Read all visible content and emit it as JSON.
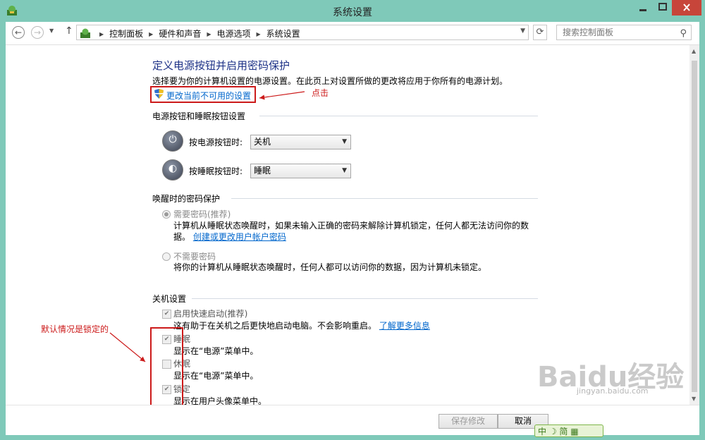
{
  "window": {
    "title": "系统设置",
    "accent": "#7fc9b9",
    "min_glyph": "▬",
    "max_glyph": "▭",
    "close_glyph": "✕"
  },
  "address": {
    "crumbs": [
      "控制面板",
      "硬件和声音",
      "电源选项",
      "系统设置"
    ],
    "search_placeholder": "搜索控制面板"
  },
  "page": {
    "title": "定义电源按钮并启用密码保护",
    "description": "选择要为你的计算机设置的电源设置。在此页上对设置所做的更改将应用于你所有的电源计划。",
    "change_link": "更改当前不可用的设置"
  },
  "power_section": {
    "heading": "电源按钮和睡眠按钮设置",
    "power_button_label": "按电源按钮时:",
    "power_button_value": "关机",
    "sleep_button_label": "按睡眠按钮时:",
    "sleep_button_value": "睡眠"
  },
  "wake_section": {
    "heading": "唤醒时的密码保护",
    "require_label": "需要密码(推荐)",
    "require_desc_1": "计算机从睡眠状态唤醒时，如果未输入正确的密码来解除计算机锁定，任何人都无法访问你的数",
    "require_desc_2": "据。",
    "require_link": "创建或更改用户帐户密码",
    "no_require_label": "不需要密码",
    "no_require_desc": "将你的计算机从睡眠状态唤醒时，任何人都可以访问你的数据，因为计算机未锁定。",
    "selected": "require"
  },
  "shutdown_section": {
    "heading": "关机设置",
    "fast_startup_label": "启用快速启动(推荐)",
    "fast_startup_desc": "这有助于在关机之后更快地启动电脑。不会影响重启。",
    "fast_startup_link": "了解更多信息",
    "fast_startup_checked": true,
    "sleep_label": "睡眠",
    "sleep_desc": "显示在“电源”菜单中。",
    "sleep_checked": true,
    "hibernate_label": "休眠",
    "hibernate_desc": "显示在“电源”菜单中。",
    "hibernate_checked": false,
    "lock_label": "锁定",
    "lock_desc": "显示在用户头像菜单中。",
    "lock_checked": true
  },
  "annotations": {
    "click": "点击",
    "default_locked": "默认情况是锁定的",
    "color": "#cc1a1a"
  },
  "footer": {
    "save_label": "保存修改",
    "cancel_label": "取消"
  },
  "watermark": {
    "text": "Baidu经验",
    "url": "jingyan.baidu.com"
  },
  "ime": {
    "text": "中 ☽ 简 ▦"
  }
}
